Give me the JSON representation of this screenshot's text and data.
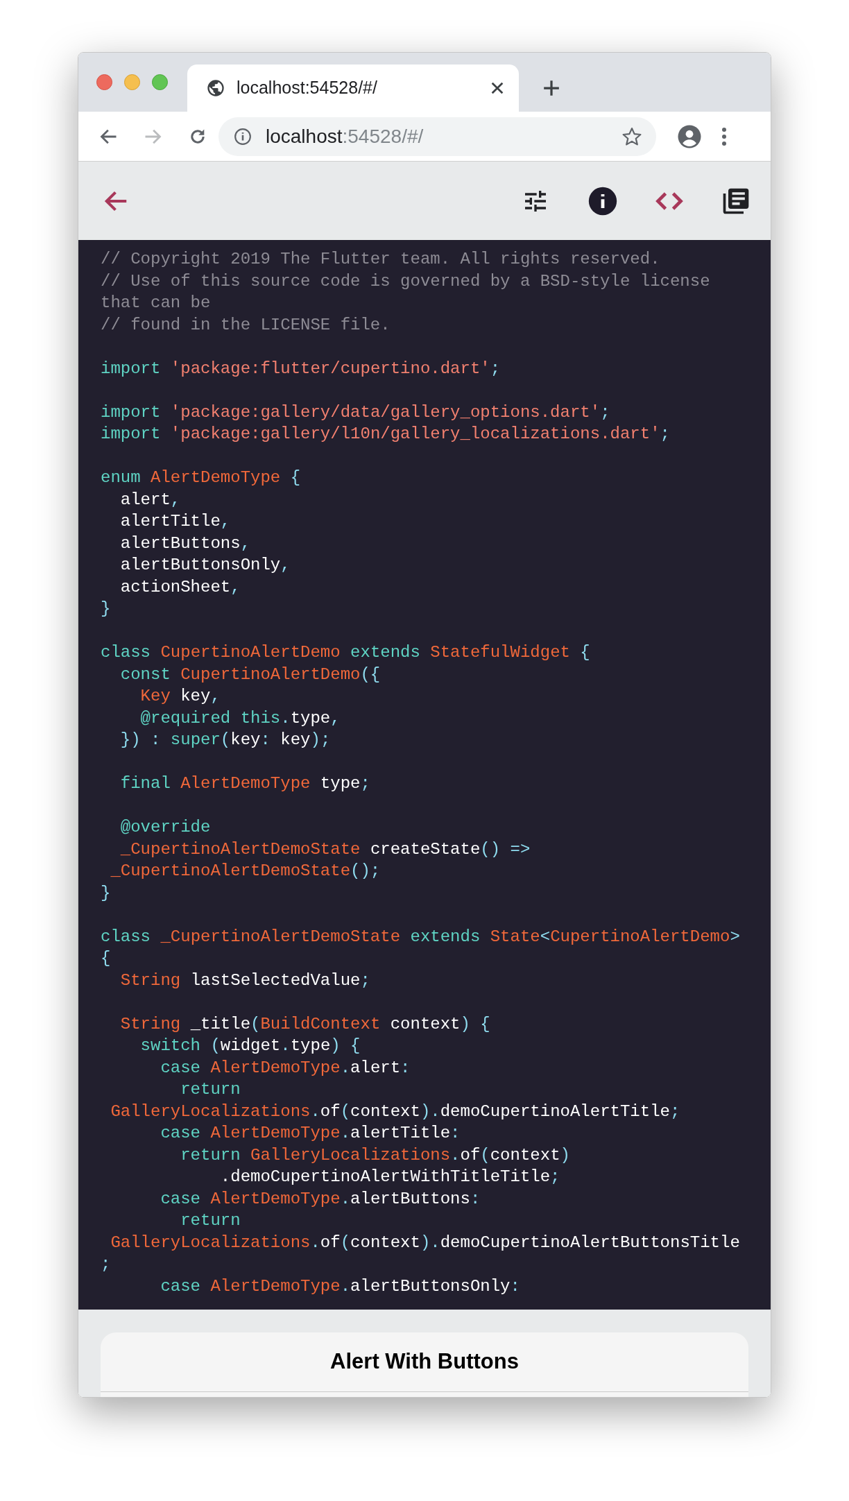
{
  "browser": {
    "tab_title": "localhost:54528/#/",
    "url_host": "localhost",
    "url_rest": ":54528/#/"
  },
  "code": [
    {
      "kind": "code",
      "tokens": [
        {
          "kind": "comment",
          "text": "// Copyright 2019 The Flutter team. All rights reserved."
        }
      ]
    },
    {
      "kind": "code",
      "tokens": [
        {
          "kind": "comment",
          "text": "// Use of this source code is governed by a BSD-style license"
        }
      ]
    },
    {
      "kind": "code",
      "tokens": [
        {
          "kind": "comment",
          "text": "that can be"
        }
      ]
    },
    {
      "kind": "code",
      "tokens": [
        {
          "kind": "comment",
          "text": "// found in the LICENSE file."
        }
      ]
    },
    {
      "kind": "blank"
    },
    {
      "kind": "code",
      "tokens": [
        {
          "kind": "keyword",
          "text": "import "
        },
        {
          "kind": "string",
          "text": "'package:flutter/cupertino.dart'"
        },
        {
          "kind": "punct",
          "text": ";"
        }
      ]
    },
    {
      "kind": "blank"
    },
    {
      "kind": "code",
      "tokens": [
        {
          "kind": "keyword",
          "text": "import "
        },
        {
          "kind": "string",
          "text": "'package:gallery/data/gallery_options.dart'"
        },
        {
          "kind": "punct",
          "text": ";"
        }
      ]
    },
    {
      "kind": "code",
      "tokens": [
        {
          "kind": "keyword",
          "text": "import "
        },
        {
          "kind": "string",
          "text": "'package:gallery/l10n/gallery_localizations.dart'"
        },
        {
          "kind": "punct",
          "text": ";"
        }
      ]
    },
    {
      "kind": "blank"
    },
    {
      "kind": "code",
      "tokens": [
        {
          "kind": "keyword",
          "text": "enum "
        },
        {
          "kind": "type",
          "text": "AlertDemoType "
        },
        {
          "kind": "punct",
          "text": "{"
        }
      ]
    },
    {
      "kind": "code",
      "tokens": [
        {
          "kind": "plain",
          "text": "  alert"
        },
        {
          "kind": "punct",
          "text": ","
        }
      ]
    },
    {
      "kind": "code",
      "tokens": [
        {
          "kind": "plain",
          "text": "  alertTitle"
        },
        {
          "kind": "punct",
          "text": ","
        }
      ]
    },
    {
      "kind": "code",
      "tokens": [
        {
          "kind": "plain",
          "text": "  alertButtons"
        },
        {
          "kind": "punct",
          "text": ","
        }
      ]
    },
    {
      "kind": "code",
      "tokens": [
        {
          "kind": "plain",
          "text": "  alertButtonsOnly"
        },
        {
          "kind": "punct",
          "text": ","
        }
      ]
    },
    {
      "kind": "code",
      "tokens": [
        {
          "kind": "plain",
          "text": "  actionSheet"
        },
        {
          "kind": "punct",
          "text": ","
        }
      ]
    },
    {
      "kind": "code",
      "tokens": [
        {
          "kind": "punct",
          "text": "}"
        }
      ]
    },
    {
      "kind": "blank"
    },
    {
      "kind": "code",
      "tokens": [
        {
          "kind": "keyword",
          "text": "class "
        },
        {
          "kind": "type",
          "text": "CupertinoAlertDemo "
        },
        {
          "kind": "keyword",
          "text": "extends "
        },
        {
          "kind": "type",
          "text": "StatefulWidget "
        },
        {
          "kind": "punct",
          "text": "{"
        }
      ]
    },
    {
      "kind": "code",
      "tokens": [
        {
          "kind": "keyword",
          "text": "  const "
        },
        {
          "kind": "type",
          "text": "CupertinoAlertDemo"
        },
        {
          "kind": "punct",
          "text": "({"
        }
      ]
    },
    {
      "kind": "code",
      "tokens": [
        {
          "kind": "type",
          "text": "    Key "
        },
        {
          "kind": "plain",
          "text": "key"
        },
        {
          "kind": "punct",
          "text": ","
        }
      ]
    },
    {
      "kind": "code",
      "tokens": [
        {
          "kind": "keyword",
          "text": "    @required this"
        },
        {
          "kind": "punct",
          "text": "."
        },
        {
          "kind": "plain",
          "text": "type"
        },
        {
          "kind": "punct",
          "text": ","
        }
      ]
    },
    {
      "kind": "code",
      "tokens": [
        {
          "kind": "punct",
          "text": "  }) : "
        },
        {
          "kind": "keyword",
          "text": "super"
        },
        {
          "kind": "punct",
          "text": "("
        },
        {
          "kind": "plain",
          "text": "key"
        },
        {
          "kind": "punct",
          "text": ": "
        },
        {
          "kind": "plain",
          "text": "key"
        },
        {
          "kind": "punct",
          "text": ");"
        }
      ]
    },
    {
      "kind": "blank"
    },
    {
      "kind": "code",
      "tokens": [
        {
          "kind": "keyword",
          "text": "  final "
        },
        {
          "kind": "type",
          "text": "AlertDemoType "
        },
        {
          "kind": "plain",
          "text": "type"
        },
        {
          "kind": "punct",
          "text": ";"
        }
      ]
    },
    {
      "kind": "blank"
    },
    {
      "kind": "code",
      "tokens": [
        {
          "kind": "keyword",
          "text": "  @override"
        }
      ]
    },
    {
      "kind": "code",
      "tokens": [
        {
          "kind": "type",
          "text": "  _CupertinoAlertDemoState "
        },
        {
          "kind": "plain",
          "text": "createState"
        },
        {
          "kind": "punct",
          "text": "() =>"
        }
      ]
    },
    {
      "kind": "code",
      "tokens": [
        {
          "kind": "type",
          "text": " _CupertinoAlertDemoState"
        },
        {
          "kind": "punct",
          "text": "();"
        }
      ]
    },
    {
      "kind": "code",
      "tokens": [
        {
          "kind": "punct",
          "text": "}"
        }
      ]
    },
    {
      "kind": "blank"
    },
    {
      "kind": "code",
      "tokens": [
        {
          "kind": "keyword",
          "text": "class "
        },
        {
          "kind": "type",
          "text": "_CupertinoAlertDemoState "
        },
        {
          "kind": "keyword",
          "text": "extends "
        },
        {
          "kind": "type",
          "text": "State"
        },
        {
          "kind": "punct",
          "text": "<"
        },
        {
          "kind": "type",
          "text": "CupertinoAlertDemo"
        },
        {
          "kind": "punct",
          "text": ">"
        }
      ]
    },
    {
      "kind": "code",
      "tokens": [
        {
          "kind": "punct",
          "text": "{"
        }
      ]
    },
    {
      "kind": "code",
      "tokens": [
        {
          "kind": "type",
          "text": "  String "
        },
        {
          "kind": "plain",
          "text": "lastSelectedValue"
        },
        {
          "kind": "punct",
          "text": ";"
        }
      ]
    },
    {
      "kind": "blank"
    },
    {
      "kind": "code",
      "tokens": [
        {
          "kind": "type",
          "text": "  String "
        },
        {
          "kind": "plain",
          "text": "_title"
        },
        {
          "kind": "punct",
          "text": "("
        },
        {
          "kind": "type",
          "text": "BuildContext "
        },
        {
          "kind": "plain",
          "text": "context"
        },
        {
          "kind": "punct",
          "text": ") {"
        }
      ]
    },
    {
      "kind": "code",
      "tokens": [
        {
          "kind": "keyword",
          "text": "    switch "
        },
        {
          "kind": "punct",
          "text": "("
        },
        {
          "kind": "plain",
          "text": "widget"
        },
        {
          "kind": "punct",
          "text": "."
        },
        {
          "kind": "plain",
          "text": "type"
        },
        {
          "kind": "punct",
          "text": ") {"
        }
      ]
    },
    {
      "kind": "code",
      "tokens": [
        {
          "kind": "keyword",
          "text": "      case "
        },
        {
          "kind": "type",
          "text": "AlertDemoType"
        },
        {
          "kind": "punct",
          "text": "."
        },
        {
          "kind": "plain",
          "text": "alert"
        },
        {
          "kind": "punct",
          "text": ":"
        }
      ]
    },
    {
      "kind": "code",
      "tokens": [
        {
          "kind": "keyword",
          "text": "        return"
        }
      ]
    },
    {
      "kind": "code",
      "tokens": [
        {
          "kind": "type",
          "text": " GalleryLocalizations"
        },
        {
          "kind": "punct",
          "text": "."
        },
        {
          "kind": "plain",
          "text": "of"
        },
        {
          "kind": "punct",
          "text": "("
        },
        {
          "kind": "plain",
          "text": "context"
        },
        {
          "kind": "punct",
          "text": ")."
        },
        {
          "kind": "plain",
          "text": "demoCupertinoAlertTitle"
        },
        {
          "kind": "punct",
          "text": ";"
        }
      ]
    },
    {
      "kind": "code",
      "tokens": [
        {
          "kind": "keyword",
          "text": "      case "
        },
        {
          "kind": "type",
          "text": "AlertDemoType"
        },
        {
          "kind": "punct",
          "text": "."
        },
        {
          "kind": "plain",
          "text": "alertTitle"
        },
        {
          "kind": "punct",
          "text": ":"
        }
      ]
    },
    {
      "kind": "code",
      "tokens": [
        {
          "kind": "keyword",
          "text": "        return "
        },
        {
          "kind": "type",
          "text": "GalleryLocalizations"
        },
        {
          "kind": "punct",
          "text": "."
        },
        {
          "kind": "plain",
          "text": "of"
        },
        {
          "kind": "punct",
          "text": "("
        },
        {
          "kind": "plain",
          "text": "context"
        },
        {
          "kind": "punct",
          "text": ")"
        }
      ]
    },
    {
      "kind": "code",
      "tokens": [
        {
          "kind": "plain",
          "text": "            .demoCupertinoAlertWithTitleTitle"
        },
        {
          "kind": "punct",
          "text": ";"
        }
      ]
    },
    {
      "kind": "code",
      "tokens": [
        {
          "kind": "keyword",
          "text": "      case "
        },
        {
          "kind": "type",
          "text": "AlertDemoType"
        },
        {
          "kind": "punct",
          "text": "."
        },
        {
          "kind": "plain",
          "text": "alertButtons"
        },
        {
          "kind": "punct",
          "text": ":"
        }
      ]
    },
    {
      "kind": "code",
      "tokens": [
        {
          "kind": "keyword",
          "text": "        return"
        }
      ]
    },
    {
      "kind": "code",
      "tokens": [
        {
          "kind": "type",
          "text": " GalleryLocalizations"
        },
        {
          "kind": "punct",
          "text": "."
        },
        {
          "kind": "plain",
          "text": "of"
        },
        {
          "kind": "punct",
          "text": "("
        },
        {
          "kind": "plain",
          "text": "context"
        },
        {
          "kind": "punct",
          "text": ")."
        },
        {
          "kind": "plain",
          "text": "demoCupertinoAlertButtonsTitle"
        }
      ]
    },
    {
      "kind": "code",
      "tokens": [
        {
          "kind": "punct",
          "text": ";"
        }
      ]
    },
    {
      "kind": "code",
      "tokens": [
        {
          "kind": "keyword",
          "text": "      case "
        },
        {
          "kind": "type",
          "text": "AlertDemoType"
        },
        {
          "kind": "punct",
          "text": "."
        },
        {
          "kind": "plain",
          "text": "alertButtonsOnly"
        },
        {
          "kind": "punct",
          "text": ":"
        }
      ]
    }
  ],
  "sheet": {
    "title": "Alert With Buttons"
  }
}
